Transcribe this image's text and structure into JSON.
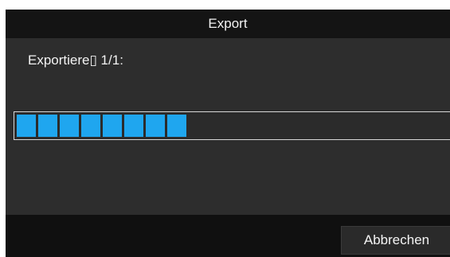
{
  "dialog": {
    "title": "Export",
    "status_text": "Exportiere▯ 1/1:",
    "progress": {
      "filled_segments": 8,
      "color": "#1fa6ef"
    },
    "cancel_label": "Abbrechen"
  },
  "colors": {
    "title_bar": "#141414",
    "panel": "#2d2d2d",
    "footer": "#101010",
    "accent": "#1fa6ef"
  }
}
